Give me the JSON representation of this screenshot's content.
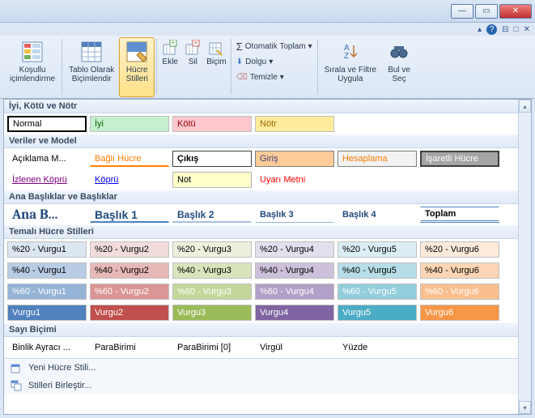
{
  "titlebar": {
    "minimize": "—",
    "maximize": "▭",
    "close": "✕"
  },
  "helpbar": {
    "caret": "▴",
    "help": "?",
    "win1": "⊟",
    "win2": "□",
    "winclose": "✕"
  },
  "ribbon": {
    "kosullu": "Koşullu\niçimlendirme",
    "tablo": "Tablo Olarak\nBiçimlendir",
    "hucre": "Hücre\nStilleri",
    "ekle": "Ekle",
    "sil": "Sil",
    "bicim": "Biçim",
    "otomatik": "Otomatik Toplam",
    "dolgu": "Dolgu",
    "temizle": "Temizle",
    "sirala": "Sırala ve Filtre\nUygula",
    "bul": "Bul ve\nSeç"
  },
  "sections": {
    "s1": "İyi, Kötü ve Nötr",
    "s2": "Veriler ve Model",
    "s3": "Ana Başlıklar ve Başlıklar",
    "s4": "Temalı Hücre Stilleri",
    "s5": "Sayı Biçimi"
  },
  "row1": {
    "normal": "Normal",
    "iyi": "İyi",
    "kotu": "Kötü",
    "notr": "Nötr"
  },
  "row2a": {
    "aciklama": "Açıklama M...",
    "bagli": "Bağlı Hücre",
    "cikis": "Çıkış",
    "giris": "Giriş",
    "hesaplama": "Hesaplama",
    "isaretli": "İşaretli Hücre"
  },
  "row2b": {
    "izlenen": "İzlenen Köprü",
    "kopru": "Köprü",
    "not": "Not",
    "uyari": "Uyarı Metni"
  },
  "row3": {
    "ana": "Ana B...",
    "b1": "Başlık 1",
    "b2": "Başlık 2",
    "b3": "Başlık 3",
    "b4": "Başlık 4",
    "toplam": "Toplam"
  },
  "row4a": {
    "c1": "%20 - Vurgu1",
    "c2": "%20 - Vurgu2",
    "c3": "%20 - Vurgu3",
    "c4": "%20 - Vurgu4",
    "c5": "%20 - Vurgu5",
    "c6": "%20 - Vurgu6"
  },
  "row4b": {
    "c1": "%40 - Vurgu1",
    "c2": "%40 - Vurgu2",
    "c3": "%40 - Vurgu3",
    "c4": "%40 - Vurgu4",
    "c5": "%40 - Vurgu5",
    "c6": "%40 - Vurgu6"
  },
  "row4c": {
    "c1": "%60 - Vurgu1",
    "c2": "%60 - Vurgu2",
    "c3": "%60 - Vurgu3",
    "c4": "%60 - Vurgu4",
    "c5": "%60 - Vurgu5",
    "c6": "%60 - Vurgu6"
  },
  "row4d": {
    "c1": "Vurgu1",
    "c2": "Vurgu2",
    "c3": "Vurgu3",
    "c4": "Vurgu4",
    "c5": "Vurgu5",
    "c6": "Vurgu6"
  },
  "row5": {
    "binlik": "Binlik Ayracı ...",
    "para": "ParaBirimi",
    "para0": "ParaBirimi [0]",
    "virgul": "Virgül",
    "yuzde": "Yüzde"
  },
  "footer": {
    "yeni": "Yeni Hücre Stili...",
    "birlesir": "Stilleri Birleştir..."
  }
}
